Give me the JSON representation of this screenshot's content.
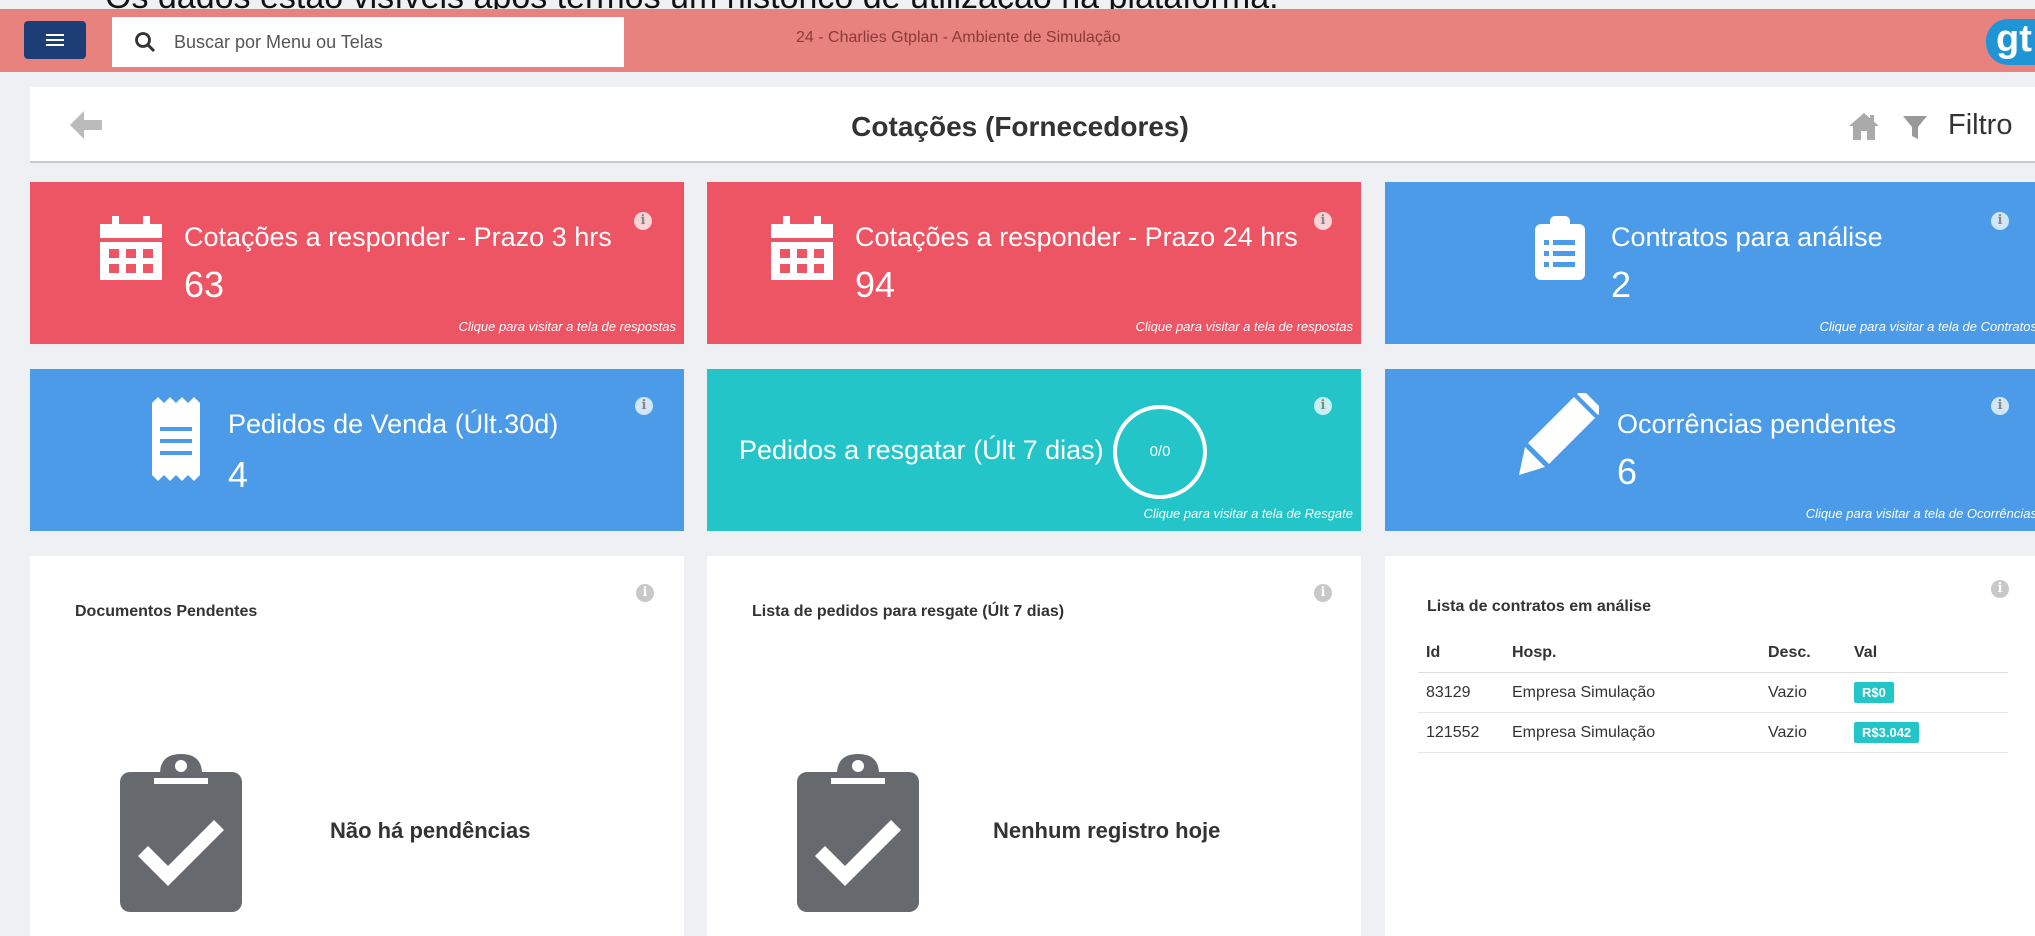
{
  "caption": "Os dados estão visíveis após termos um histórico de utilização na plataforma.",
  "topbar": {
    "search_placeholder": "Buscar por Menu ou Telas",
    "environment": "24 - Charlies Gtplan - Ambiente de Simulação",
    "logo_text": "gt"
  },
  "header": {
    "title": "Cotações (Fornecedores)",
    "filter_label": "Filtro"
  },
  "cards": {
    "quotes3": {
      "title": "Cotações a responder - Prazo 3 hrs",
      "count": "63",
      "link": "Clique para visitar a tela de respostas",
      "info": "i"
    },
    "quotes24": {
      "title": "Cotações a responder - Prazo 24 hrs",
      "count": "94",
      "link": "Clique para visitar a tela de respostas",
      "info": "i"
    },
    "contracts": {
      "title": "Contratos para análise",
      "count": "2",
      "link": "Clique para visitar a tela de Contratos",
      "info": "i"
    },
    "sales": {
      "title": "Pedidos de Venda (Últ.30d)",
      "count": "4",
      "info": "i"
    },
    "rescue": {
      "title": "Pedidos a resgatar (Últ 7 dias)",
      "ratio": "0/0",
      "link": "Clique para visitar a tela de Resgate",
      "info": "i"
    },
    "occurrences": {
      "title": "Ocorrências pendentes",
      "count": "6",
      "link": "Clique para visitar a tela de Ocorrências",
      "info": "i"
    }
  },
  "panels": {
    "docs": {
      "title": "Documentos Pendentes",
      "empty": "Não há pendências",
      "info": "i"
    },
    "rescue_list": {
      "title": "Lista de pedidos para resgate (Últ 7 dias)",
      "empty": "Nenhum registro hoje",
      "info": "i"
    },
    "contract_list": {
      "title": "Lista de contratos em análise",
      "info": "i",
      "columns": [
        "Id",
        "Hosp.",
        "Desc.",
        "Val"
      ],
      "rows": [
        [
          "83129",
          "Empresa Simulação",
          "Vazio",
          "R$0"
        ],
        [
          "121552",
          "Empresa Simulação",
          "Vazio",
          "R$3.042"
        ]
      ]
    }
  },
  "colors": {
    "red": "#ee5564",
    "blue": "#4b9be9",
    "teal": "#23c5c8",
    "topbar": "#e8827f",
    "menu": "#1d3d77"
  },
  "icons": [
    "menu-icon",
    "search-icon",
    "back-arrow-icon",
    "home-icon",
    "filter-icon",
    "calendar-icon",
    "clipboard-list-icon",
    "receipt-icon",
    "pencil-icon",
    "clipboard-check-icon",
    "info-icon"
  ]
}
